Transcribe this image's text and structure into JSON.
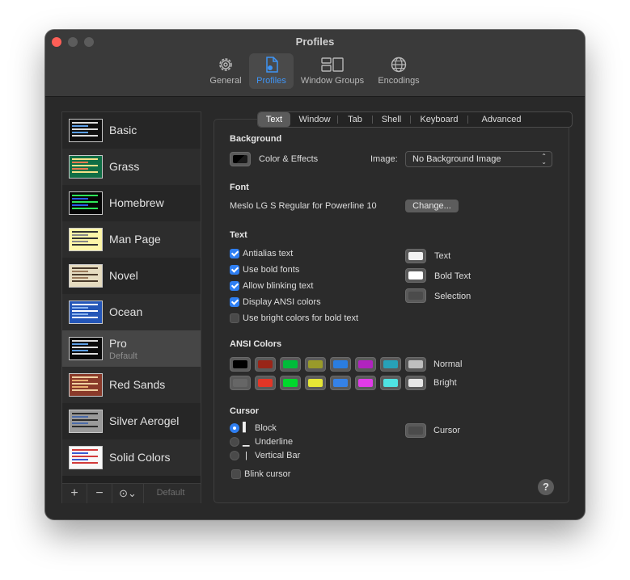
{
  "window": {
    "title": "Profiles"
  },
  "toolbar": [
    {
      "label": "General",
      "icon": "gear-icon"
    },
    {
      "label": "Profiles",
      "icon": "profiles-document-icon",
      "active": true
    },
    {
      "label": "Window Groups",
      "icon": "window-groups-icon"
    },
    {
      "label": "Encodings",
      "icon": "globe-icon"
    }
  ],
  "profiles": [
    {
      "name": "Basic",
      "bg": "#101010",
      "bars": [
        "#dddddd",
        "#5b9ee6"
      ]
    },
    {
      "name": "Grass",
      "bg": "#0f6e45",
      "bars": [
        "#f4e28a",
        "#e87a4e"
      ]
    },
    {
      "name": "Homebrew",
      "bg": "#050505",
      "bars": [
        "#2ee55a",
        "#2a5be8"
      ]
    },
    {
      "name": "Man Page",
      "bg": "#fdf6a8",
      "bars": [
        "#333333",
        "#888888"
      ]
    },
    {
      "name": "Novel",
      "bg": "#e6dcc0",
      "bars": [
        "#4a3a2a",
        "#9a7a5a"
      ]
    },
    {
      "name": "Ocean",
      "bg": "#2456b8",
      "bars": [
        "#ffffff",
        "#8ab4f0"
      ]
    },
    {
      "name": "Pro",
      "sub": "Default",
      "bg": "#0a0a0a",
      "bars": [
        "#dddddd",
        "#5b9ee6"
      ],
      "selected": true
    },
    {
      "name": "Red Sands",
      "bg": "#8a3a2a",
      "bars": [
        "#f0d0a0",
        "#e8b070"
      ]
    },
    {
      "name": "Silver Aerogel",
      "bg": "#9a9a9a",
      "bars": [
        "#2a2a2a",
        "#4a6aa8"
      ]
    },
    {
      "name": "Solid Colors",
      "bg": "#f8f8f8",
      "bars": [
        "#d23a3a",
        "#3a5ad2"
      ]
    }
  ],
  "sidebar_footer": {
    "add": "+",
    "remove": "−",
    "more": "⊙⌄",
    "default": "Default"
  },
  "tabs": [
    "Text",
    "Window",
    "Tab",
    "Shell",
    "Keyboard",
    "Advanced"
  ],
  "background": {
    "heading": "Background",
    "color_effects": "Color & Effects",
    "image_label": "Image:",
    "image_value": "No Background Image"
  },
  "font": {
    "heading": "Font",
    "value": "Meslo LG S Regular for Powerline 10",
    "change": "Change..."
  },
  "text": {
    "heading": "Text",
    "options": [
      {
        "label": "Antialias text",
        "checked": true
      },
      {
        "label": "Use bold fonts",
        "checked": true
      },
      {
        "label": "Allow blinking text",
        "checked": true
      },
      {
        "label": "Display ANSI colors",
        "checked": true
      },
      {
        "label": "Use bright colors for bold text",
        "checked": false
      }
    ],
    "colors": [
      {
        "label": "Text",
        "color": "#f2f2f2"
      },
      {
        "label": "Bold Text",
        "color": "#ffffff"
      },
      {
        "label": "Selection",
        "color": "#4b4b4b"
      }
    ]
  },
  "ansi": {
    "heading": "ANSI Colors",
    "normal_label": "Normal",
    "bright_label": "Bright",
    "normal": [
      "#000000",
      "#992518",
      "#00bc3a",
      "#999a2a",
      "#2a7de0",
      "#b123bf",
      "#27a1b8",
      "#bfbfbf"
    ],
    "bright": [
      "#666666",
      "#e33627",
      "#00d82c",
      "#e6e636",
      "#3582e8",
      "#e13be8",
      "#4fe3e3",
      "#e6e6e6"
    ]
  },
  "cursor": {
    "heading": "Cursor",
    "options": [
      {
        "glyph": "▌",
        "label": "Block",
        "selected": true
      },
      {
        "glyph": "▁",
        "label": "Underline",
        "selected": false
      },
      {
        "glyph": "|",
        "label": "Vertical Bar",
        "selected": false
      }
    ],
    "blink_label": "Blink cursor",
    "color_label": "Cursor",
    "color": "#4b4b4b"
  },
  "help": "?"
}
